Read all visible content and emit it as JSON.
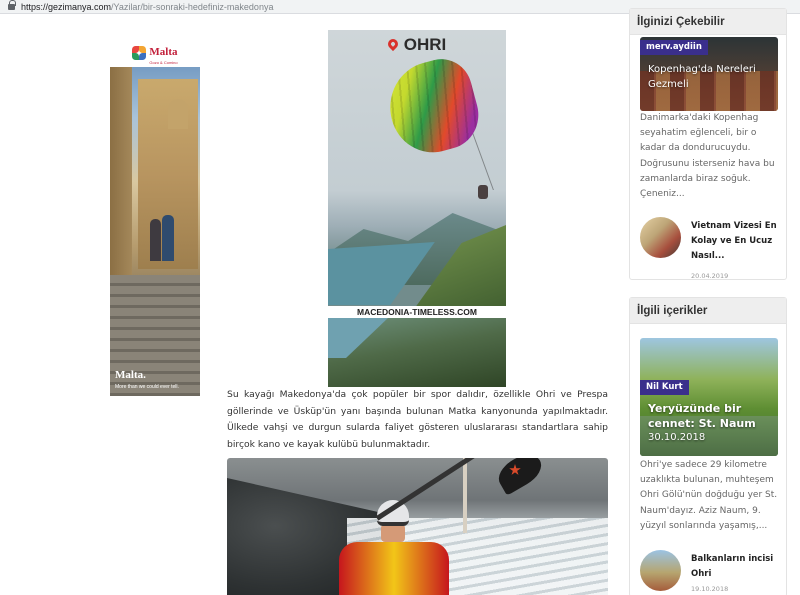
{
  "browser": {
    "url_host": "https://gezimanya.com",
    "url_path": "/Yazilar/bir-sonraki-hedefiniz-makedonya"
  },
  "ads": {
    "malta": {
      "logo": "Malta",
      "logo_sub": "Gozo & Comino",
      "brand": "Malta.",
      "tagline": "More than we could ever tell."
    },
    "ohri": {
      "title": "OHRI",
      "caption": "MACEDONIA-TIMELESS.COM"
    }
  },
  "article": {
    "paragraph": "Su kayağı Makedonya'da çok popüler bir spor dalıdır, özellikle Ohri ve Prespa göllerinde ve Üsküp'ün yanı başında bulunan Matka kanyonunda yapılmaktadır. Ülkede vahşi ve durgun sularda faliyet gösteren uluslararası standartlara sahip birçok kano ve kayak kulübü bulunmaktadır."
  },
  "sidebar": {
    "widget1": {
      "title": "İlginizi Çekebilir",
      "featured": {
        "author": "merv.aydiin",
        "title": "Kopenhag'da Nereleri Gezmeli",
        "excerpt": "Danimarka'daki Kopenhag seyahatim eğlenceli, bir o kadar da dondurucuydu. Doğrusunu isterseniz hava bu zamanlarda biraz soğuk. Çeneniz..."
      },
      "item": {
        "title": "Vietnam Vizesi En Kolay ve En Ucuz Nasıl...",
        "date": "20.04.2019"
      }
    },
    "widget2": {
      "title": "İlgili içerikler",
      "featured": {
        "author": "Nil Kurt",
        "title": "Yeryüzünde bir cennet: St. Naum",
        "date": "30.10.2018",
        "excerpt": "Ohri'ye sadece 29 kilometre uzaklıkta bulunan, muhteşem Ohri Gölü'nün doğduğu yer St. Naum'dayız. Aziz Naum, 9. yüzyıl sonlarında yaşamış,..."
      },
      "item": {
        "title": "Balkanların incisi Ohri",
        "date": "19.10.2018"
      }
    }
  },
  "colors": {
    "badge": "#3a2f8c",
    "malta_red": "#c21f3a",
    "pin_red": "#d9312b"
  }
}
